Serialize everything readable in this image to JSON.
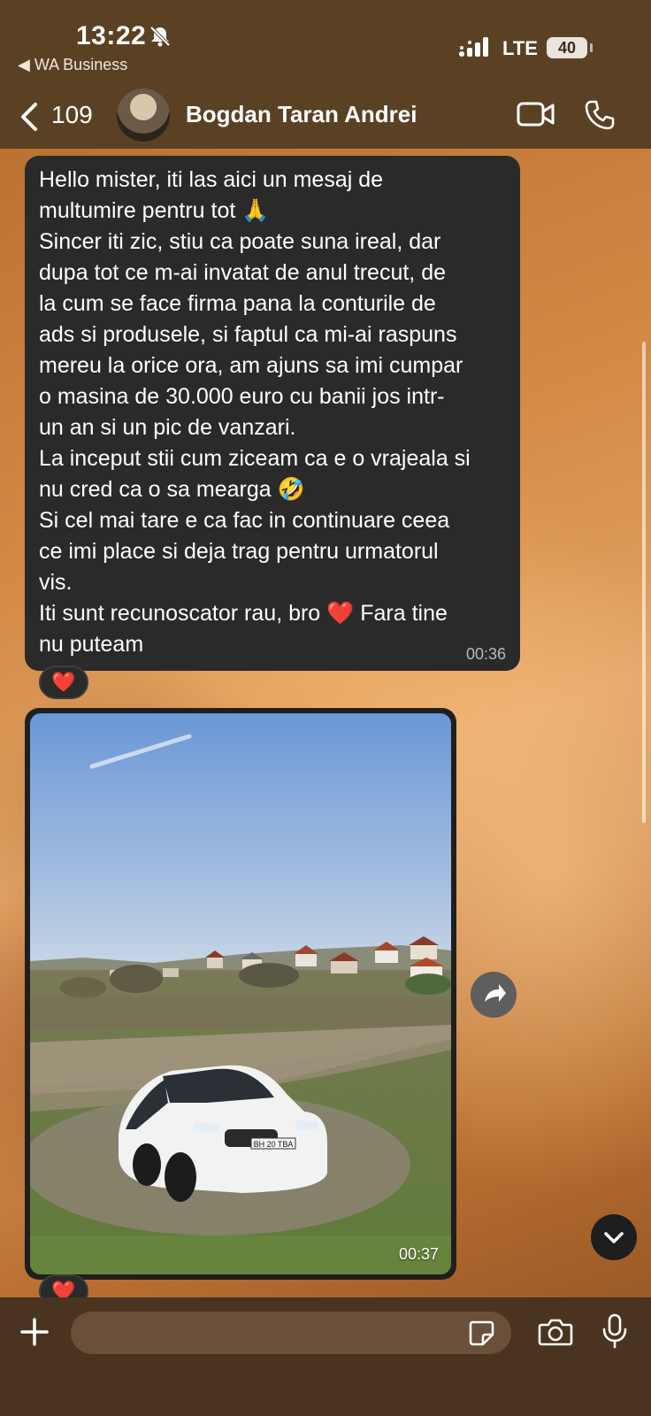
{
  "status_bar": {
    "time": "13:22",
    "back_app": "◀ WA Business",
    "network": "LTE",
    "battery": "40"
  },
  "header": {
    "unread_count": "109",
    "contact_name": "Bogdan Taran Andrei"
  },
  "messages": {
    "text_message": {
      "lines": [
        "Hello mister, iti las aici un mesaj de",
        "multumire pentru tot 🙏",
        "Sincer iti zic, stiu ca poate suna ireal, dar",
        "dupa tot ce m-ai invatat de anul trecut, de",
        "la cum se face firma pana la conturile de",
        "ads si produsele, si faptul ca mi-ai raspuns",
        "mereu la orice ora, am ajuns sa imi cumpar",
        "o masina de 30.000 euro cu banii jos intr-",
        "un an si un pic de vanzari.",
        "La inceput stii cum ziceam ca e o vrajeala si",
        "nu cred ca o sa mearga 🤣",
        "Si cel mai tare e ca fac in continuare ceea",
        "ce imi place si deja trag pentru urmatorul",
        "vis.",
        "Iti sunt recunoscator rau, bro ❤️ Fara tine",
        "nu puteam"
      ],
      "time": "00:36",
      "reaction": "❤️"
    },
    "photo_message": {
      "time": "00:37",
      "reaction": "❤️",
      "license_plate": "BH 20 TBA"
    }
  },
  "composer": {
    "placeholder": ""
  }
}
